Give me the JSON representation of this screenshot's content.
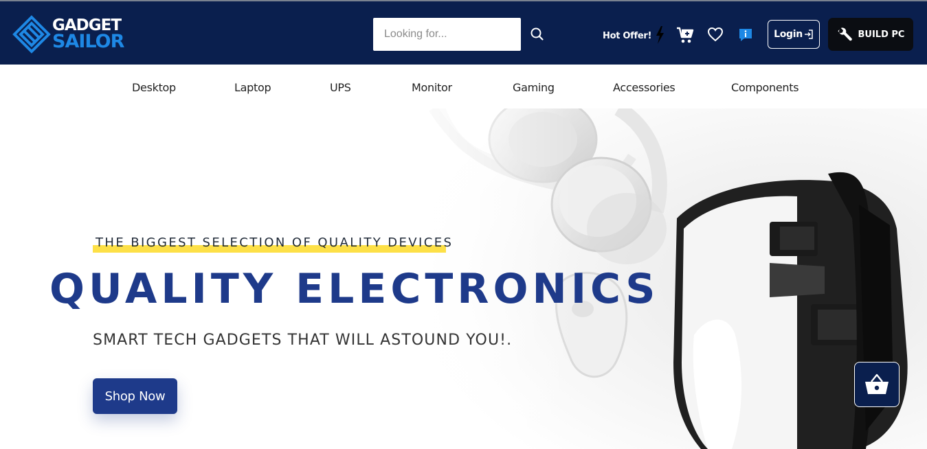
{
  "header": {
    "logo": {
      "line1": "GADGET",
      "line2": "SAILOR"
    },
    "search": {
      "placeholder": "Looking for...",
      "value": ""
    },
    "hot_offer_label": "Hot Offer!",
    "login_label": "Login",
    "build_pc_label": "BUILD PC",
    "icons": [
      "search-icon",
      "lightning-bolt-icon",
      "cart-icon",
      "heart-icon",
      "info-icon",
      "login-icon",
      "wrench-icon"
    ]
  },
  "nav": {
    "items": [
      {
        "label": "Desktop"
      },
      {
        "label": "Laptop"
      },
      {
        "label": "UPS"
      },
      {
        "label": "Monitor"
      },
      {
        "label": "Gaming"
      },
      {
        "label": "Accessories"
      },
      {
        "label": "Components"
      }
    ]
  },
  "hero": {
    "eyebrow": "THE BIGGEST SELECTION OF QUALITY DEVICES",
    "title": "QUALITY ELECTRONICS",
    "subtitle": "SMART TECH GADGETS THAT WILL ASTOUND YOU!.",
    "cta_label": "Shop Now",
    "image": "headphones-and-vr-headset-photo"
  },
  "floating": {
    "icon": "basket-icon"
  },
  "colors": {
    "header_bg": "#0a1f4e",
    "brand_blue": "#1e3a8a",
    "logo_blue": "#1e88e5",
    "highlight_yellow": "#fde047",
    "build_btn_bg": "#0b0d12"
  }
}
